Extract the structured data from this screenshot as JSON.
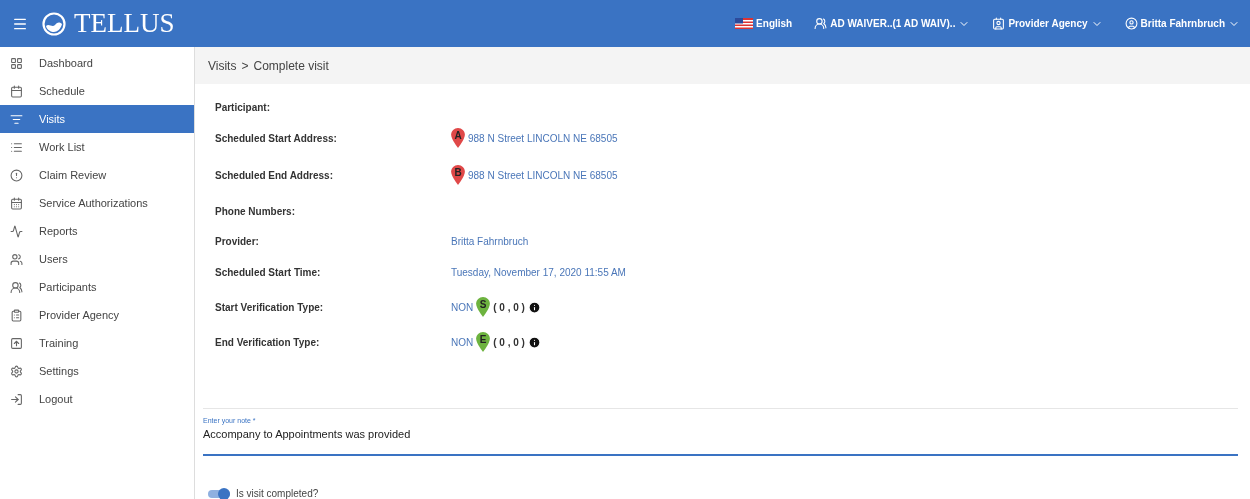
{
  "header": {
    "brand": "TELLUS",
    "language": "English",
    "program": "AD WAIVER..(1 AD WAIV)..",
    "agency": "Provider Agency",
    "user": "Britta Fahrnbruch"
  },
  "sidebar": {
    "items": [
      {
        "label": "Dashboard",
        "selected": false
      },
      {
        "label": "Schedule",
        "selected": false
      },
      {
        "label": "Visits",
        "selected": true
      },
      {
        "label": "Work List",
        "selected": false
      },
      {
        "label": "Claim Review",
        "selected": false
      },
      {
        "label": "Service Authorizations",
        "selected": false
      },
      {
        "label": "Reports",
        "selected": false
      },
      {
        "label": "Users",
        "selected": false
      },
      {
        "label": "Participants",
        "selected": false
      },
      {
        "label": "Provider Agency",
        "selected": false
      },
      {
        "label": "Training",
        "selected": false
      },
      {
        "label": "Settings",
        "selected": false
      },
      {
        "label": "Logout",
        "selected": false
      }
    ]
  },
  "breadcrumb": {
    "parent": "Visits",
    "separator": ">",
    "current": "Complete visit"
  },
  "details": [
    {
      "label": "Participant:",
      "kind": "empty"
    },
    {
      "label": "Scheduled Start Address:",
      "kind": "address",
      "pin": "A",
      "value": "988 N Street LINCOLN NE 68505"
    },
    {
      "label": "Scheduled End Address:",
      "kind": "address",
      "pin": "B",
      "value": "988 N Street LINCOLN NE 68505"
    },
    {
      "label": "Phone Numbers:",
      "kind": "empty"
    },
    {
      "label": "Provider:",
      "kind": "link",
      "value": "Britta Fahrnbruch"
    },
    {
      "label": "Scheduled Start Time:",
      "kind": "link",
      "value": "Tuesday, November 17, 2020 11:55 AM"
    },
    {
      "label": "Start Verification Type:",
      "kind": "verification",
      "value": "NON",
      "pin": "S",
      "coords": "( 0 , 0 )"
    },
    {
      "label": "End Verification Type:",
      "kind": "verification",
      "value": "NON",
      "pin": "E",
      "coords": "( 0 , 0 )"
    }
  ],
  "note": {
    "label": "Enter your note *",
    "value": "Accompany to Appointments was provided"
  },
  "completed": {
    "label": "Is visit completed?",
    "on": true
  }
}
